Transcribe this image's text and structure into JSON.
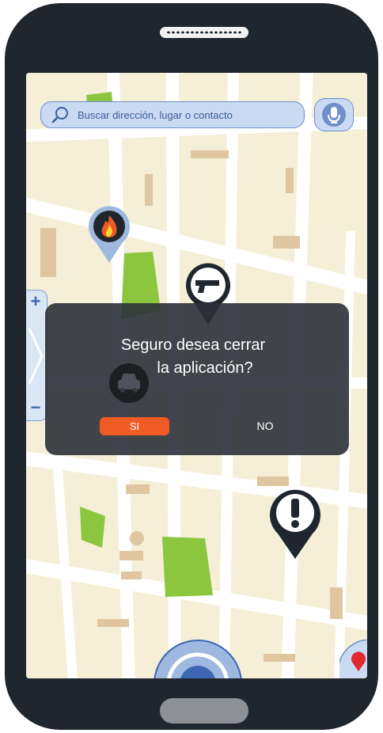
{
  "search": {
    "placeholder": "Buscar dirección, lugar o contacto"
  },
  "icons": {
    "search": "search-icon",
    "mic": "microphone-icon",
    "fire_marker": "fire-marker-icon",
    "gun_marker": "gun-marker-icon",
    "car_marker": "car-marker-icon",
    "alert_marker": "exclamation-marker-icon",
    "location": "location-pin-icon",
    "nav": "navigation-button"
  },
  "zoom": {
    "in_label": "+",
    "out_label": "−"
  },
  "dialog": {
    "line1": "Seguro desea cerrar",
    "line2": "la aplicación?",
    "yes_label": "SI",
    "no_label": "NO"
  },
  "colors": {
    "map_base": "#f4efd6",
    "road": "#ffffff",
    "park": "#8cc63f",
    "building": "#dfc6a0",
    "accent_blue": "#c9daf2",
    "dialog_bg": "#2c3038",
    "yes_button": "#f05a24",
    "phone_frame": "#1f262e"
  }
}
